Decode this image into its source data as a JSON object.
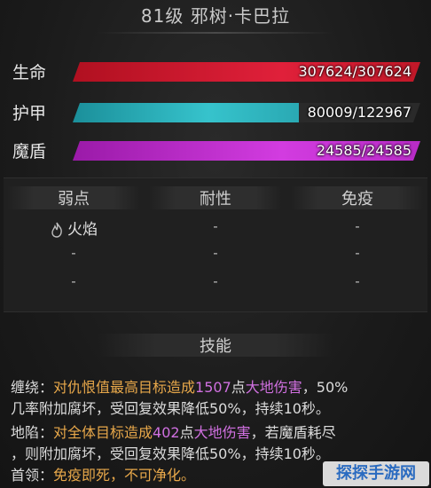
{
  "header": {
    "title": "81级 邪树·卡巴拉"
  },
  "stats": [
    {
      "label": "生命",
      "value_text": "307624/307624",
      "fraction": 1.0,
      "color": "#e0203a"
    },
    {
      "label": "护甲",
      "value_text": "80009/122967",
      "fraction": 0.651,
      "color": "#36c3cc"
    },
    {
      "label": "魔盾",
      "value_text": "24585/24585",
      "fraction": 1.0,
      "color": "#d23ce0"
    }
  ],
  "resistances": {
    "headers": [
      "弱点",
      "耐性",
      "免疫"
    ],
    "rows": [
      [
        "火焰",
        "-",
        "-"
      ],
      [
        "-",
        "-",
        "-"
      ],
      [
        "-",
        "-",
        "-"
      ]
    ],
    "icon": "fire-icon"
  },
  "skills": {
    "header": "技能",
    "items": [
      {
        "name": "缠绕：",
        "p1": "对仇恨值最高目标造成",
        "num": "1507",
        "p2": "点",
        "dmg": "大地伤害",
        "p3": "，50%",
        "line2": "几率附加腐坏，受回复效果降低50%，持续10秒。"
      },
      {
        "name": "地陷：",
        "p1": "对全体目标造成",
        "num": "402",
        "p2": "点",
        "dmg": "大地伤害",
        "p3": "，若魔盾耗尽",
        "line2": "，则附加腐坏，受回复效果降低50%，持续10秒。"
      },
      {
        "name": "首领：",
        "p1": "免疫即死，不可净化。"
      }
    ]
  },
  "watermark": "探探手游网"
}
